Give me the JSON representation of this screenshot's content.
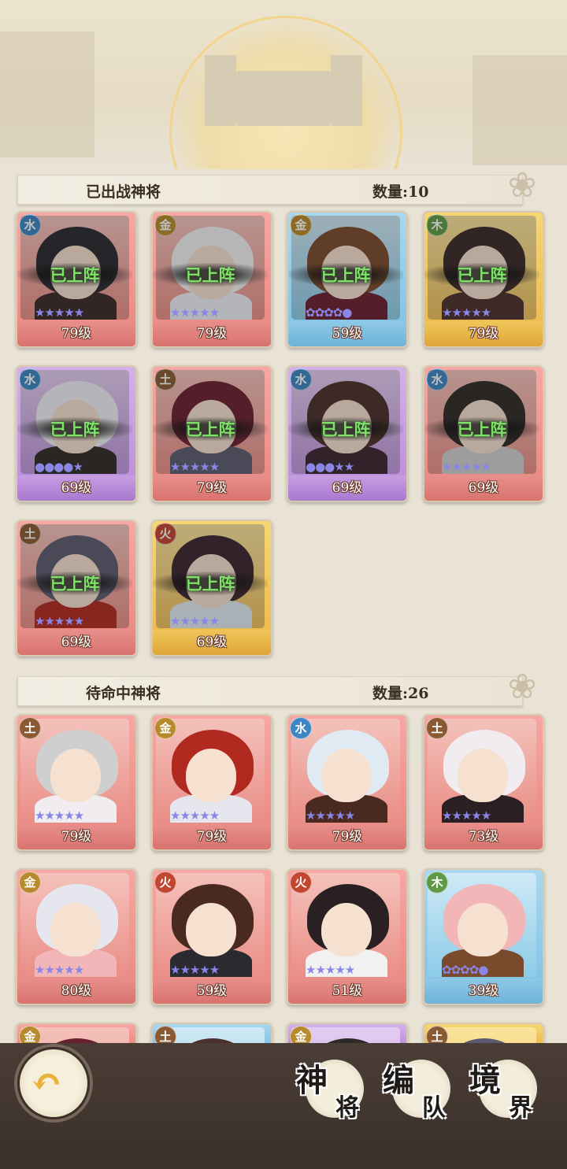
{
  "deployed_section": {
    "title": "已出战神将",
    "count": "数量:10"
  },
  "standby_section": {
    "title": "待命中神将",
    "count": "数量:26"
  },
  "deployed_label": "已上阵",
  "deployed_cards": [
    {
      "element": "水",
      "level": "79级",
      "stars": "★★★★★"
    },
    {
      "element": "金",
      "level": "79级",
      "stars": "★★★★★"
    },
    {
      "element": "金",
      "level": "59级",
      "stars": "✿✿✿✿●"
    },
    {
      "element": "木",
      "level": "79级",
      "stars": "★★★★★"
    },
    {
      "element": "水",
      "level": "69级",
      "stars": "●●●●★"
    },
    {
      "element": "土",
      "level": "79级",
      "stars": "★★★★★"
    },
    {
      "element": "水",
      "level": "69级",
      "stars": "●●●★★"
    },
    {
      "element": "水",
      "level": "69级",
      "stars": "★★★★★"
    },
    {
      "element": "土",
      "level": "69级",
      "stars": "★★★★★"
    },
    {
      "element": "火",
      "level": "69级",
      "stars": "★★★★★"
    }
  ],
  "standby_cards": [
    {
      "element": "土",
      "level": "79级",
      "stars": "★★★★★"
    },
    {
      "element": "金",
      "level": "79级",
      "stars": "★★★★★"
    },
    {
      "element": "水",
      "level": "79级",
      "stars": "★★★★★"
    },
    {
      "element": "土",
      "level": "73级",
      "stars": "★★★★★"
    },
    {
      "element": "金",
      "level": "80级",
      "stars": "★★★★★"
    },
    {
      "element": "火",
      "level": "59级",
      "stars": "★★★★★"
    },
    {
      "element": "火",
      "level": "51级",
      "stars": "★★★★★"
    },
    {
      "element": "木",
      "level": "39级",
      "stars": "✿✿✿✿●"
    }
  ],
  "partial_cards": [
    {
      "element": "金"
    },
    {
      "element": "土"
    },
    {
      "element": "金"
    },
    {
      "element": "土"
    }
  ],
  "nav": {
    "back_icon": "back-arrow-icon",
    "heroes": {
      "big": "神",
      "small": "将"
    },
    "formation": {
      "big": "编",
      "small": "队"
    },
    "realm": {
      "big": "境",
      "small": "界"
    }
  },
  "colors": {
    "metal": "#b78a2e",
    "water": "#3e86c2",
    "wood": "#5e9a45",
    "earth": "#8a5a34",
    "fire": "#c2452f"
  }
}
